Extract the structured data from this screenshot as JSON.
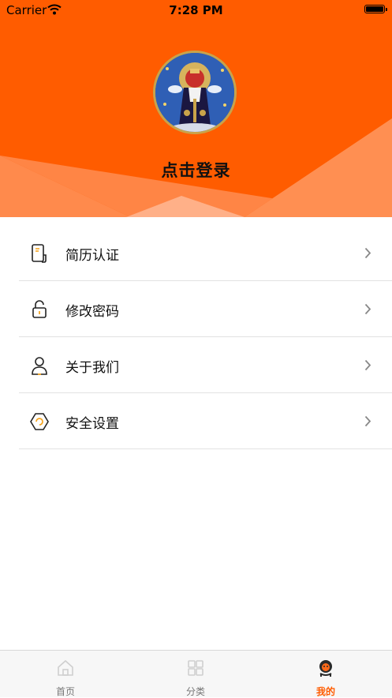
{
  "status_bar": {
    "carrier": "Carrier",
    "time": "7:28 PM"
  },
  "header": {
    "login_text": "点击登录"
  },
  "menu": [
    {
      "label": "简历认证",
      "icon": "resume-icon"
    },
    {
      "label": "修改密码",
      "icon": "lock-icon"
    },
    {
      "label": "关于我们",
      "icon": "user-icon"
    },
    {
      "label": "安全设置",
      "icon": "shield-hexagon-icon"
    }
  ],
  "tabbar": {
    "items": [
      {
        "label": "首页",
        "icon": "home-icon",
        "active": false
      },
      {
        "label": "分类",
        "icon": "grid-icon",
        "active": false
      },
      {
        "label": "我的",
        "icon": "profile-icon",
        "active": true
      }
    ]
  },
  "colors": {
    "accent": "#ff5c00",
    "header_light": "#ff9a60"
  }
}
